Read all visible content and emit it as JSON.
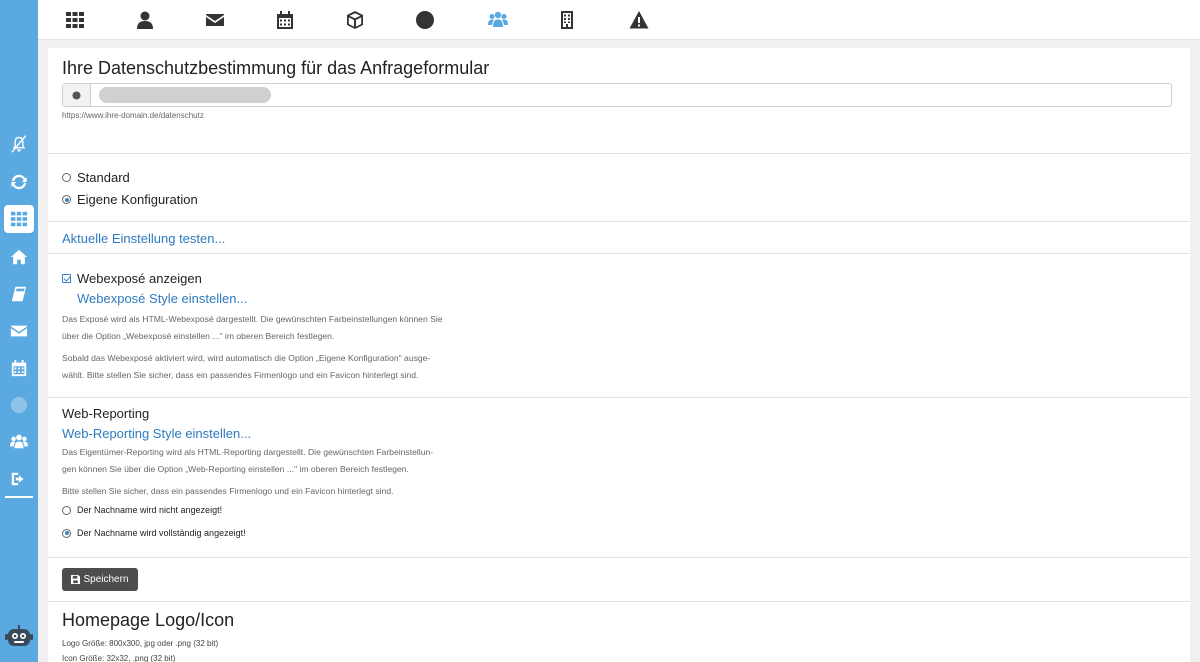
{
  "privacy": {
    "title": "Ihre Datenschutzbestimmung für das Anfrageformular",
    "url_value": "",
    "url_help": "https://www.ihre-domain.de/datenschutz"
  },
  "config": {
    "options": [
      {
        "label": "Standard",
        "checked": false
      },
      {
        "label": "Eigene Konfiguration",
        "checked": true
      }
    ]
  },
  "test_link": "Aktuelle Einstellung testen...",
  "webexpose": {
    "checkbox_label": "Webexposé anzeigen",
    "checked": true,
    "style_link": "Webexposé Style einstellen...",
    "para1_line1": "Das Exposé wird als HTML-Webexposé dargestellt. Die gewünschten Farbeinstellungen können Sie",
    "para1_line2": "über die Option „Webexposé einstellen ...\" im oberen Bereich festlegen.",
    "para2_line1": "Sobald das Webexposé aktiviert wird, wird automatisch die Option „Eigene Konfiguration\" ausge-",
    "para2_line2": "wählt. Bitte stellen Sie sicher, dass ein passendes Firmenlogo und ein Favicon hinterlegt sind."
  },
  "webreporting": {
    "title": "Web-Reporting",
    "style_link": "Web-Reporting Style einstellen...",
    "para1_line1": "Das Eigentümer-Reporting wird als HTML-Reporting dargestellt. Die gewünschten Farbeinstellun-",
    "para1_line2": "gen können Sie über die Option „Web-Reporting einstellen ...\" im oberen Bereich festlegen.",
    "para2": "Bitte stellen Sie sicher, dass ein passendes Firmenlogo und ein Favicon hinterlegt sind.",
    "options": [
      {
        "label": "Der Nachname wird nicht angezeigt!",
        "checked": false
      },
      {
        "label": "Der Nachname wird vollständig angezeigt!",
        "checked": true
      }
    ]
  },
  "save_button": "Speichern",
  "homepage": {
    "title": "Homepage Logo/Icon",
    "logo_size": "Logo Größe: 800x300, jpg oder .png (32 bit)",
    "icon_size": "Icon Größe: 32x32, .png (32 bit)"
  },
  "icons": {
    "toolbar": [
      "grid-icon",
      "user-icon",
      "envelope-icon",
      "calendar-icon",
      "cube-icon",
      "globe-icon",
      "users-icon",
      "building-icon",
      "warning-icon"
    ],
    "sidebar": [
      "bell-slash-icon",
      "refresh-icon",
      "grid-icon",
      "home-icon",
      "book-icon",
      "envelope-icon",
      "calendar-icon",
      "globe-icon",
      "users-icon",
      "sign-out-icon",
      "robot-icon"
    ]
  },
  "colors": {
    "sidebar": "#5aa9e0",
    "link": "#2f7bc0",
    "button": "#4d4d4d"
  }
}
